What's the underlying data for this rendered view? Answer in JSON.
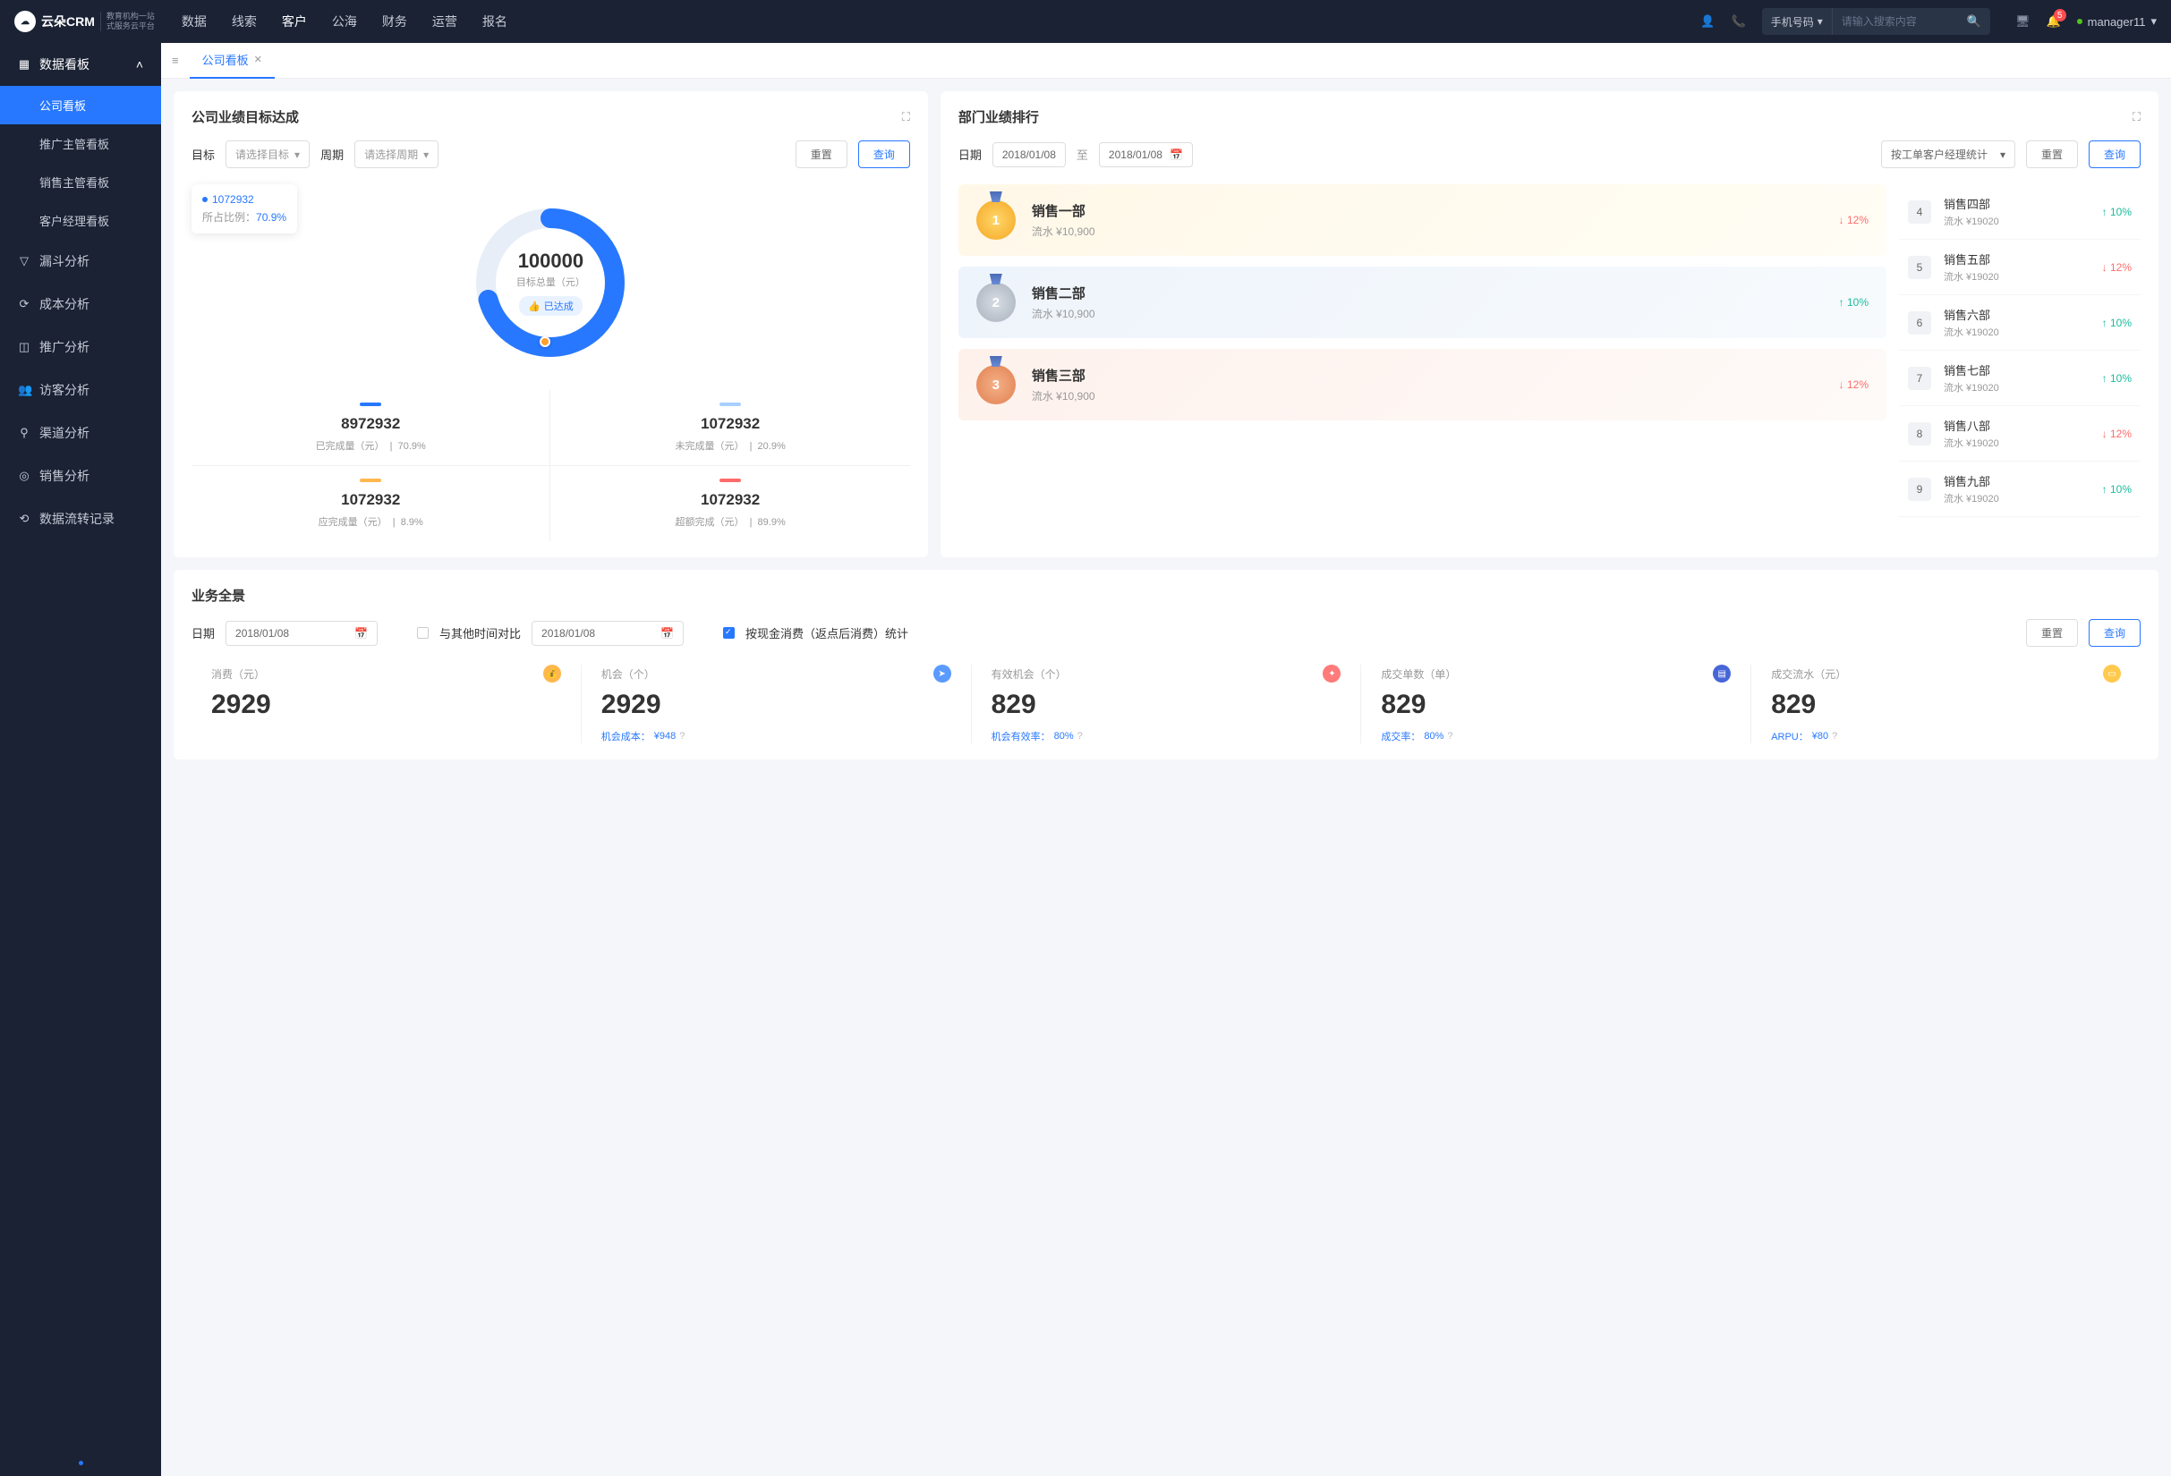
{
  "header": {
    "logo_main": "云朵CRM",
    "logo_sub1": "教育机构一站",
    "logo_sub2": "式服务云平台",
    "nav": [
      "数据",
      "线索",
      "客户",
      "公海",
      "财务",
      "运营",
      "报名"
    ],
    "search_type": "手机号码",
    "search_placeholder": "请输入搜索内容",
    "notif_count": "5",
    "username": "manager11"
  },
  "sidebar": {
    "group_title": "数据看板",
    "subs": [
      "公司看板",
      "推广主管看板",
      "销售主管看板",
      "客户经理看板"
    ],
    "items": [
      "漏斗分析",
      "成本分析",
      "推广分析",
      "访客分析",
      "渠道分析",
      "销售分析",
      "数据流转记录"
    ]
  },
  "tabs": {
    "active": "公司看板"
  },
  "target_card": {
    "title": "公司业绩目标达成",
    "label_target": "目标",
    "placeholder_target": "请选择目标",
    "label_period": "周期",
    "placeholder_period": "请选择周期",
    "btn_reset": "重置",
    "btn_query": "查询",
    "tooltip_value": "1072932",
    "tooltip_label": "所占比例：",
    "tooltip_pct": "70.9%",
    "donut_value": "100000",
    "donut_label": "目标总量（元）",
    "donut_badge": "已达成",
    "stats": [
      {
        "color": "#2878ff",
        "value": "8972932",
        "label": "已完成量（元）",
        "pct": "70.9%"
      },
      {
        "color": "#a8cfff",
        "value": "1072932",
        "label": "未完成量（元）",
        "pct": "20.9%"
      },
      {
        "color": "#ffb84d",
        "value": "1072932",
        "label": "应完成量（元）",
        "pct": "8.9%"
      },
      {
        "color": "#ff6b6b",
        "value": "1072932",
        "label": "超额完成（元）",
        "pct": "89.9%"
      }
    ]
  },
  "rank_card": {
    "title": "部门业绩排行",
    "label_date": "日期",
    "date_from": "2018/01/08",
    "date_to_label": "至",
    "date_to": "2018/01/08",
    "filter_select": "按工单客户经理统计",
    "btn_reset": "重置",
    "btn_query": "查询",
    "top3": [
      {
        "rank": "1",
        "name": "销售一部",
        "sub": "流水 ¥10,900",
        "pct": "12%",
        "dir": "down"
      },
      {
        "rank": "2",
        "name": "销售二部",
        "sub": "流水 ¥10,900",
        "pct": "10%",
        "dir": "up"
      },
      {
        "rank": "3",
        "name": "销售三部",
        "sub": "流水 ¥10,900",
        "pct": "12%",
        "dir": "down"
      }
    ],
    "rest": [
      {
        "rank": "4",
        "name": "销售四部",
        "sub": "流水 ¥19020",
        "pct": "10%",
        "dir": "up"
      },
      {
        "rank": "5",
        "name": "销售五部",
        "sub": "流水 ¥19020",
        "pct": "12%",
        "dir": "down"
      },
      {
        "rank": "6",
        "name": "销售六部",
        "sub": "流水 ¥19020",
        "pct": "10%",
        "dir": "up"
      },
      {
        "rank": "7",
        "name": "销售七部",
        "sub": "流水 ¥19020",
        "pct": "10%",
        "dir": "up"
      },
      {
        "rank": "8",
        "name": "销售八部",
        "sub": "流水 ¥19020",
        "pct": "12%",
        "dir": "down"
      },
      {
        "rank": "9",
        "name": "销售九部",
        "sub": "流水 ¥19020",
        "pct": "10%",
        "dir": "up"
      }
    ]
  },
  "overview_card": {
    "title": "业务全景",
    "label_date": "日期",
    "date1": "2018/01/08",
    "compare_label": "与其他时间对比",
    "date2": "2018/01/08",
    "check_label": "按现金消费（返点后消费）统计",
    "btn_reset": "重置",
    "btn_query": "查询",
    "items": [
      {
        "label": "消费（元）",
        "value": "2929",
        "sub": "",
        "icon": "orange",
        "glyph": "💰"
      },
      {
        "label": "机会（个）",
        "value": "2929",
        "sub_label": "机会成本：",
        "sub_val": "¥948",
        "icon": "blue",
        "glyph": "➤"
      },
      {
        "label": "有效机会（个）",
        "value": "829",
        "sub_label": "机会有效率：",
        "sub_val": "80%",
        "icon": "red",
        "glyph": "✦"
      },
      {
        "label": "成交单数（单）",
        "value": "829",
        "sub_label": "成交率：",
        "sub_val": "80%",
        "icon": "darkblue",
        "glyph": "▤"
      },
      {
        "label": "成交流水（元）",
        "value": "829",
        "sub_label": "ARPU：",
        "sub_val": "¥80",
        "icon": "yellow",
        "glyph": "▭"
      }
    ]
  },
  "chart_data": {
    "type": "pie",
    "title": "目标总量（元）",
    "total": 100000,
    "series": [
      {
        "name": "已完成量（元）",
        "value": 8972932,
        "pct": 70.9,
        "color": "#2878ff"
      },
      {
        "name": "未完成量（元）",
        "value": 1072932,
        "pct": 20.9,
        "color": "#a8cfff"
      },
      {
        "name": "应完成量（元）",
        "value": 1072932,
        "pct": 8.9,
        "color": "#ffb84d"
      },
      {
        "name": "超额完成（元）",
        "value": 1072932,
        "pct": 89.9,
        "color": "#ff6b6b"
      }
    ]
  }
}
